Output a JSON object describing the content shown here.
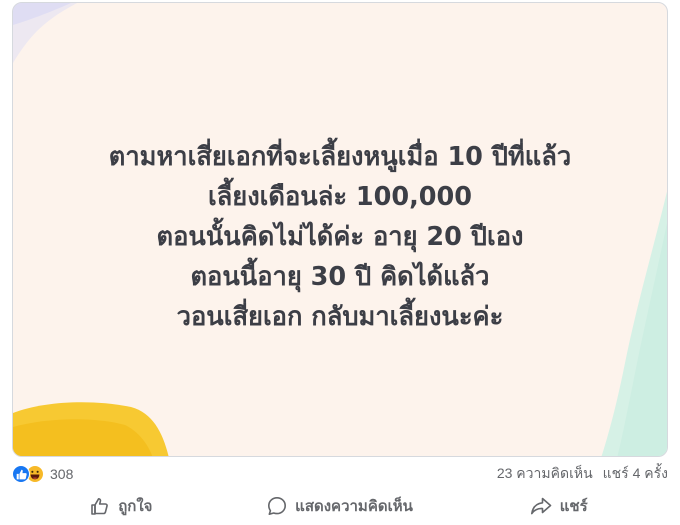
{
  "post": {
    "text_lines": [
      "ตามหาเสี่ยเอกที่จะเลี้ยงหนูเมื่อ 10 ปีที่แล้ว",
      "เลี้ยงเดือนล่ะ 100,000",
      "ตอนนั้นคิดไม่ได้ค่ะ อายุ 20 ปีเอง",
      "ตอนนี้อายุ 30 ปี คิดได้แล้ว",
      "วอนเสี่ยเอก กลับมาเลี้ยงนะค่ะ"
    ],
    "background_color": "#fdf3ec",
    "text_color": "#3c3e46"
  },
  "stats": {
    "reaction_icons": [
      "like-icon",
      "haha-icon"
    ],
    "reaction_count": "308",
    "comments": "23 ความคิดเห็น",
    "shares": "แชร์ 4 ครั้ง"
  },
  "actions": {
    "like_label": "ถูกใจ",
    "comment_label": "แสดงความคิดเห็น",
    "share_label": "แชร์"
  },
  "colors": {
    "like_blue": "#1877f2",
    "haha_yellow": "#f7b928",
    "muted_text": "#65676b"
  }
}
